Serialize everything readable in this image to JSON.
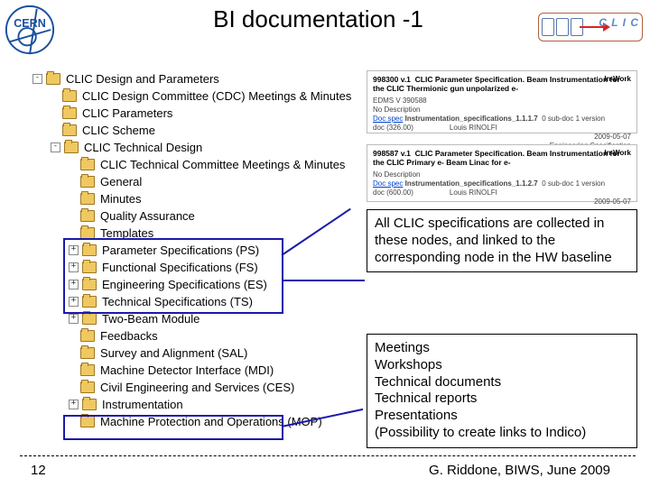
{
  "header": {
    "title": "BI documentation -1",
    "cern_label": "CERN",
    "clic_label": "C L I C"
  },
  "tree": {
    "items": [
      {
        "level": 1,
        "expander": "-",
        "label": "CLIC Design and Parameters"
      },
      {
        "level": 2,
        "expander": "",
        "label": "CLIC Design Committee (CDC) Meetings & Minutes"
      },
      {
        "level": 2,
        "expander": "",
        "label": "CLIC Parameters"
      },
      {
        "level": 2,
        "expander": "",
        "label": "CLIC Scheme"
      },
      {
        "level": 2,
        "expander": "-",
        "label": "CLIC Technical Design"
      },
      {
        "level": 3,
        "expander": "",
        "label": "CLIC Technical Committee Meetings & Minutes"
      },
      {
        "level": 3,
        "expander": "",
        "label": "General"
      },
      {
        "level": 3,
        "expander": "",
        "label": "Minutes"
      },
      {
        "level": 3,
        "expander": "",
        "label": "Quality Assurance"
      },
      {
        "level": 3,
        "expander": "",
        "label": "Templates"
      },
      {
        "level": 3,
        "expander": "+",
        "label": "Parameter Specifications (PS)"
      },
      {
        "level": 3,
        "expander": "+",
        "label": "Functional Specifications (FS)"
      },
      {
        "level": 3,
        "expander": "+",
        "label": "Engineering Specifications (ES)"
      },
      {
        "level": 3,
        "expander": "+",
        "label": "Technical Specifications (TS)"
      },
      {
        "level": 3,
        "expander": "+",
        "label": "Two-Beam Module"
      },
      {
        "level": 3,
        "expander": "",
        "label": "Feedbacks"
      },
      {
        "level": 3,
        "expander": "",
        "label": "Survey and Alignment (SAL)"
      },
      {
        "level": 3,
        "expander": "",
        "label": "Machine Detector Interface (MDI)"
      },
      {
        "level": 3,
        "expander": "",
        "label": "Civil Engineering and Services (CES)"
      },
      {
        "level": 3,
        "expander": "+",
        "label": "Instrumentation"
      },
      {
        "level": 3,
        "expander": "",
        "label": "Machine Protection and Operations (MOP)"
      }
    ]
  },
  "cards": {
    "c1": {
      "ref": "998300 v.1",
      "title": "CLIC Parameter Specification. Beam Instrumentation for the CLIC Thermionic gun unpolarized e-",
      "status": "In-Work",
      "id2": "EDMS V 390588",
      "desc_label": "No Description",
      "link": "Doc spec",
      "file": "Instrumentation_specifications_1.1.1.7",
      "sub": "0 sub-doc   1 version",
      "doc_label": "doc (326.00)",
      "author": "Louis RINOLFI",
      "date": "2009-05-07",
      "kind": "Engineering Specification"
    },
    "c2": {
      "ref": "998587 v.1",
      "title": "CLIC Parameter Specification. Beam Instrumentation for the CLIC Primary e- Beam Linac for e-",
      "status": "In-Work",
      "desc_label": "No Description",
      "link": "Doc spec",
      "file": "Instrumentation_specifications_1.1.2.7",
      "sub": "0 sub-doc   1 version",
      "doc_label": "doc (600.00)",
      "author": "Louis RINOLFI",
      "date": "2009-05-07"
    }
  },
  "notes": {
    "n1": "All CLIC specifications are collected in these nodes, and linked to the corresponding node in the HW baseline",
    "n2": "Meetings\nWorkshops\nTechnical documents\nTechnical reports\nPresentations\n(Possibility to create links to Indico)"
  },
  "footer": {
    "slide_number": "12",
    "author_line": "G. Riddone, BIWS, June 2009"
  }
}
